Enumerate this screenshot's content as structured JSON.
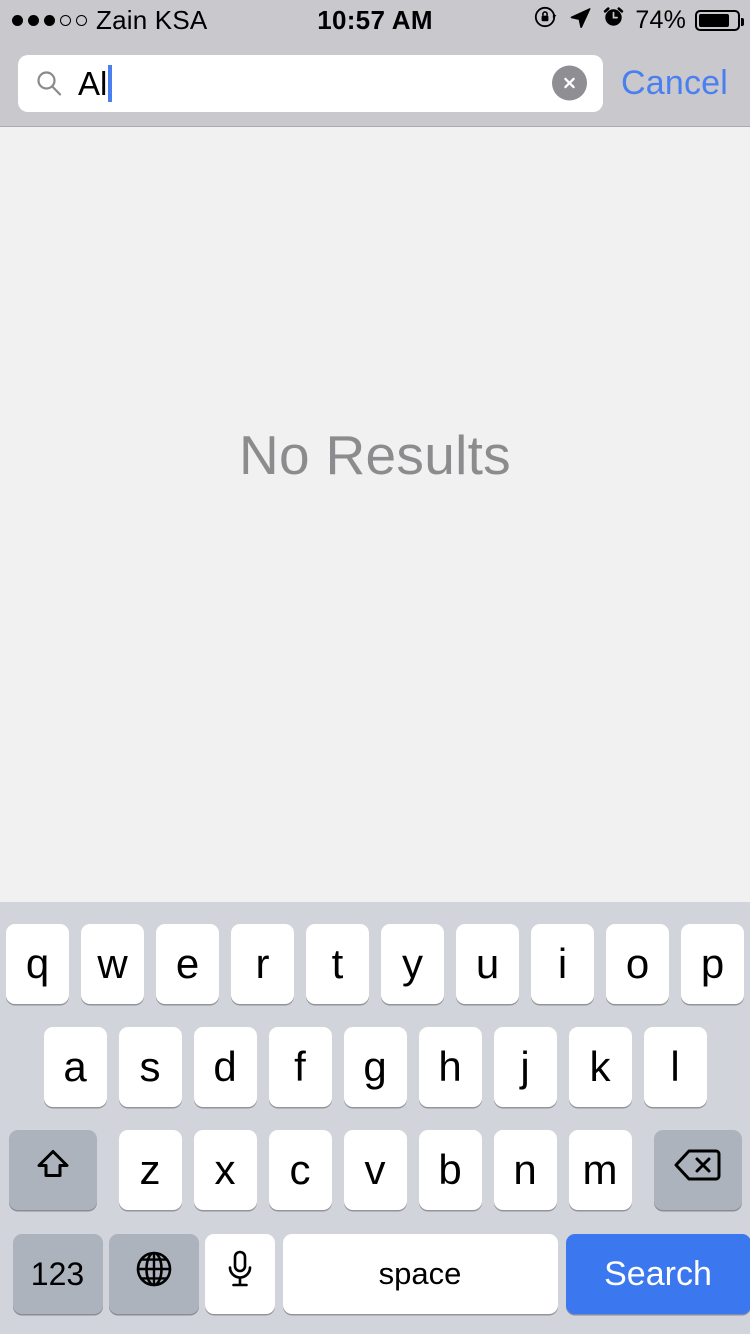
{
  "status_bar": {
    "carrier": "Zain KSA",
    "signal_dots_total": 5,
    "signal_dots_filled": 3,
    "time": "10:57 AM",
    "battery_percent": "74%",
    "battery_level": 74,
    "icons": [
      "rotation-lock-icon",
      "location-arrow-icon",
      "alarm-clock-icon"
    ]
  },
  "search": {
    "value": "Al",
    "placeholder": "Search",
    "cancel_label": "Cancel",
    "clear_icon": "clear-circle-icon",
    "search_icon": "search-icon"
  },
  "content": {
    "empty_state": "No Results"
  },
  "keyboard": {
    "row1": [
      "q",
      "w",
      "e",
      "r",
      "t",
      "y",
      "u",
      "i",
      "o",
      "p"
    ],
    "row2": [
      "a",
      "s",
      "d",
      "f",
      "g",
      "h",
      "j",
      "k",
      "l"
    ],
    "row3": [
      "z",
      "x",
      "c",
      "v",
      "b",
      "n",
      "m"
    ],
    "shift_icon": "shift-arrow-icon",
    "backspace_icon": "backspace-delete-icon",
    "numeric_label": "123",
    "globe_icon": "globe-icon",
    "mic_icon": "microphone-icon",
    "space_label": "space",
    "search_label": "Search"
  },
  "colors": {
    "accent_blue": "#4a7ff0",
    "key_blue": "#3b77ef",
    "chrome_gray": "#c8c8cd",
    "keyboard_bg": "#d1d4da",
    "content_bg": "#f1f1f1",
    "empty_text": "#8c8c8e"
  }
}
